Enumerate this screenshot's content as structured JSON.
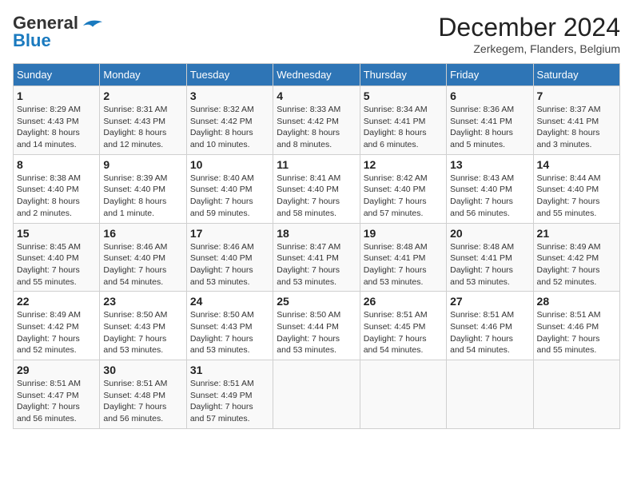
{
  "logo": {
    "line1": "General",
    "line2": "Blue"
  },
  "title": "December 2024",
  "location": "Zerkegem, Flanders, Belgium",
  "days_of_week": [
    "Sunday",
    "Monday",
    "Tuesday",
    "Wednesday",
    "Thursday",
    "Friday",
    "Saturday"
  ],
  "weeks": [
    [
      {
        "day": "1",
        "info": "Sunrise: 8:29 AM\nSunset: 4:43 PM\nDaylight: 8 hours\nand 14 minutes."
      },
      {
        "day": "2",
        "info": "Sunrise: 8:31 AM\nSunset: 4:43 PM\nDaylight: 8 hours\nand 12 minutes."
      },
      {
        "day": "3",
        "info": "Sunrise: 8:32 AM\nSunset: 4:42 PM\nDaylight: 8 hours\nand 10 minutes."
      },
      {
        "day": "4",
        "info": "Sunrise: 8:33 AM\nSunset: 4:42 PM\nDaylight: 8 hours\nand 8 minutes."
      },
      {
        "day": "5",
        "info": "Sunrise: 8:34 AM\nSunset: 4:41 PM\nDaylight: 8 hours\nand 6 minutes."
      },
      {
        "day": "6",
        "info": "Sunrise: 8:36 AM\nSunset: 4:41 PM\nDaylight: 8 hours\nand 5 minutes."
      },
      {
        "day": "7",
        "info": "Sunrise: 8:37 AM\nSunset: 4:41 PM\nDaylight: 8 hours\nand 3 minutes."
      }
    ],
    [
      {
        "day": "8",
        "info": "Sunrise: 8:38 AM\nSunset: 4:40 PM\nDaylight: 8 hours\nand 2 minutes."
      },
      {
        "day": "9",
        "info": "Sunrise: 8:39 AM\nSunset: 4:40 PM\nDaylight: 8 hours\nand 1 minute."
      },
      {
        "day": "10",
        "info": "Sunrise: 8:40 AM\nSunset: 4:40 PM\nDaylight: 7 hours\nand 59 minutes."
      },
      {
        "day": "11",
        "info": "Sunrise: 8:41 AM\nSunset: 4:40 PM\nDaylight: 7 hours\nand 58 minutes."
      },
      {
        "day": "12",
        "info": "Sunrise: 8:42 AM\nSunset: 4:40 PM\nDaylight: 7 hours\nand 57 minutes."
      },
      {
        "day": "13",
        "info": "Sunrise: 8:43 AM\nSunset: 4:40 PM\nDaylight: 7 hours\nand 56 minutes."
      },
      {
        "day": "14",
        "info": "Sunrise: 8:44 AM\nSunset: 4:40 PM\nDaylight: 7 hours\nand 55 minutes."
      }
    ],
    [
      {
        "day": "15",
        "info": "Sunrise: 8:45 AM\nSunset: 4:40 PM\nDaylight: 7 hours\nand 55 minutes."
      },
      {
        "day": "16",
        "info": "Sunrise: 8:46 AM\nSunset: 4:40 PM\nDaylight: 7 hours\nand 54 minutes."
      },
      {
        "day": "17",
        "info": "Sunrise: 8:46 AM\nSunset: 4:40 PM\nDaylight: 7 hours\nand 53 minutes."
      },
      {
        "day": "18",
        "info": "Sunrise: 8:47 AM\nSunset: 4:41 PM\nDaylight: 7 hours\nand 53 minutes."
      },
      {
        "day": "19",
        "info": "Sunrise: 8:48 AM\nSunset: 4:41 PM\nDaylight: 7 hours\nand 53 minutes."
      },
      {
        "day": "20",
        "info": "Sunrise: 8:48 AM\nSunset: 4:41 PM\nDaylight: 7 hours\nand 53 minutes."
      },
      {
        "day": "21",
        "info": "Sunrise: 8:49 AM\nSunset: 4:42 PM\nDaylight: 7 hours\nand 52 minutes."
      }
    ],
    [
      {
        "day": "22",
        "info": "Sunrise: 8:49 AM\nSunset: 4:42 PM\nDaylight: 7 hours\nand 52 minutes."
      },
      {
        "day": "23",
        "info": "Sunrise: 8:50 AM\nSunset: 4:43 PM\nDaylight: 7 hours\nand 53 minutes."
      },
      {
        "day": "24",
        "info": "Sunrise: 8:50 AM\nSunset: 4:43 PM\nDaylight: 7 hours\nand 53 minutes."
      },
      {
        "day": "25",
        "info": "Sunrise: 8:50 AM\nSunset: 4:44 PM\nDaylight: 7 hours\nand 53 minutes."
      },
      {
        "day": "26",
        "info": "Sunrise: 8:51 AM\nSunset: 4:45 PM\nDaylight: 7 hours\nand 54 minutes."
      },
      {
        "day": "27",
        "info": "Sunrise: 8:51 AM\nSunset: 4:46 PM\nDaylight: 7 hours\nand 54 minutes."
      },
      {
        "day": "28",
        "info": "Sunrise: 8:51 AM\nSunset: 4:46 PM\nDaylight: 7 hours\nand 55 minutes."
      }
    ],
    [
      {
        "day": "29",
        "info": "Sunrise: 8:51 AM\nSunset: 4:47 PM\nDaylight: 7 hours\nand 56 minutes."
      },
      {
        "day": "30",
        "info": "Sunrise: 8:51 AM\nSunset: 4:48 PM\nDaylight: 7 hours\nand 56 minutes."
      },
      {
        "day": "31",
        "info": "Sunrise: 8:51 AM\nSunset: 4:49 PM\nDaylight: 7 hours\nand 57 minutes."
      },
      {
        "day": "",
        "info": ""
      },
      {
        "day": "",
        "info": ""
      },
      {
        "day": "",
        "info": ""
      },
      {
        "day": "",
        "info": ""
      }
    ]
  ]
}
